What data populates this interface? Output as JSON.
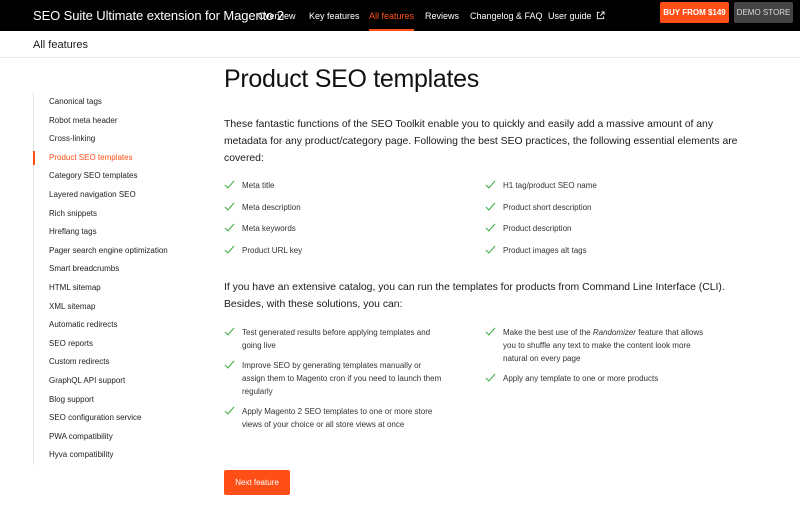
{
  "header": {
    "brand": "SEO Suite Ultimate extension for Magento 2",
    "nav": [
      {
        "label": "Overview"
      },
      {
        "label": "Key features"
      },
      {
        "label": "All features",
        "active": true
      },
      {
        "label": "Reviews"
      },
      {
        "label": "Changelog & FAQ"
      },
      {
        "label": "User guide",
        "icon": "external-link-icon"
      }
    ],
    "buy_label": "BUY FROM $149",
    "demo_label": "DEMO STORE"
  },
  "section_title": "All features",
  "sidebar": {
    "items": [
      {
        "label": "Canonical tags"
      },
      {
        "label": "Robot meta header"
      },
      {
        "label": "Cross-linking"
      },
      {
        "label": "Product SEO templates",
        "active": true
      },
      {
        "label": "Category SEO templates"
      },
      {
        "label": "Layered navigation SEO"
      },
      {
        "label": "Rich snippets"
      },
      {
        "label": "Hreflang tags"
      },
      {
        "label": "Pager search engine optimization"
      },
      {
        "label": "Smart breadcrumbs"
      },
      {
        "label": "HTML sitemap"
      },
      {
        "label": "XML sitemap"
      },
      {
        "label": "Automatic redirects"
      },
      {
        "label": "SEO reports"
      },
      {
        "label": "Custom redirects"
      },
      {
        "label": "GraphQL API support"
      },
      {
        "label": "Blog support"
      },
      {
        "label": "SEO configuration service"
      },
      {
        "label": "PWA compatibility"
      },
      {
        "label": "Hyva compatibility"
      }
    ]
  },
  "main": {
    "title": "Product SEO templates",
    "intro": "These fantastic functions of the SEO Toolkit enable you to quickly and easily add a massive amount of any metadata for any product/category page. Following the best SEO practices, the following essential elements are covered:",
    "elements_left": [
      "Meta title",
      "Meta description",
      "Meta keywords",
      "Product URL key"
    ],
    "elements_right": [
      "H1 tag/product SEO name",
      "Product short description",
      "Product description",
      "Product images alt tags"
    ],
    "cli_text": "If you have an extensive catalog, you can run the templates for products from Command Line Interface (CLI). Besides, with these solutions, you can:",
    "abilities_left": [
      "Test generated results before applying templates and going live",
      "Improve SEO by generating templates manually or assign them to Magento cron if you need to launch them regularly",
      "Apply Magento 2 SEO templates to one or more store views of your choice or all store views at once"
    ],
    "abilities_right": {
      "randomizer_before": "Make the best use of the ",
      "randomizer_word": "Randomizer",
      "randomizer_after": " feature that allows you to shuffle any text to make the content look more natural on every page",
      "apply_templates": "Apply any template to one or more products"
    },
    "next_label": "Next feature"
  },
  "colors": {
    "accent": "#ff4f17",
    "check": "#4caf50",
    "topbar": "#000000"
  }
}
